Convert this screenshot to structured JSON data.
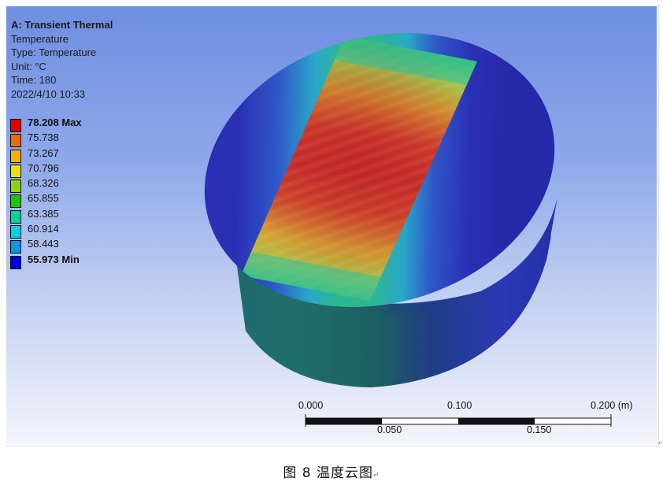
{
  "info": {
    "title": "A: Transient Thermal",
    "result": "Temperature",
    "type": "Type: Temperature",
    "unit": "Unit: °C",
    "time": "Time: 180",
    "date": "2022/4/10 10:33"
  },
  "legend": [
    {
      "label": "78.208 Max",
      "color": "#e30000",
      "bold": true
    },
    {
      "label": "75.738",
      "color": "#f06a00",
      "bold": false
    },
    {
      "label": "73.267",
      "color": "#f3b400",
      "bold": false
    },
    {
      "label": "70.796",
      "color": "#e6e600",
      "bold": false
    },
    {
      "label": "68.326",
      "color": "#8fd400",
      "bold": false
    },
    {
      "label": "65.855",
      "color": "#17c800",
      "bold": false
    },
    {
      "label": "63.385",
      "color": "#00d49c",
      "bold": false
    },
    {
      "label": "60.914",
      "color": "#00d2df",
      "bold": false
    },
    {
      "label": "58.443",
      "color": "#0099e6",
      "bold": false
    },
    {
      "label": "55.973 Min",
      "color": "#0000f0",
      "bold": true
    }
  ],
  "scale": {
    "labels_top": [
      "0.000",
      "0.100",
      "0.200 (m)"
    ],
    "labels_bottom": [
      "0.050",
      "0.150"
    ]
  },
  "caption": {
    "text": "图  8 温度云图",
    "mark": "↵"
  },
  "edge_mark": "↵"
}
